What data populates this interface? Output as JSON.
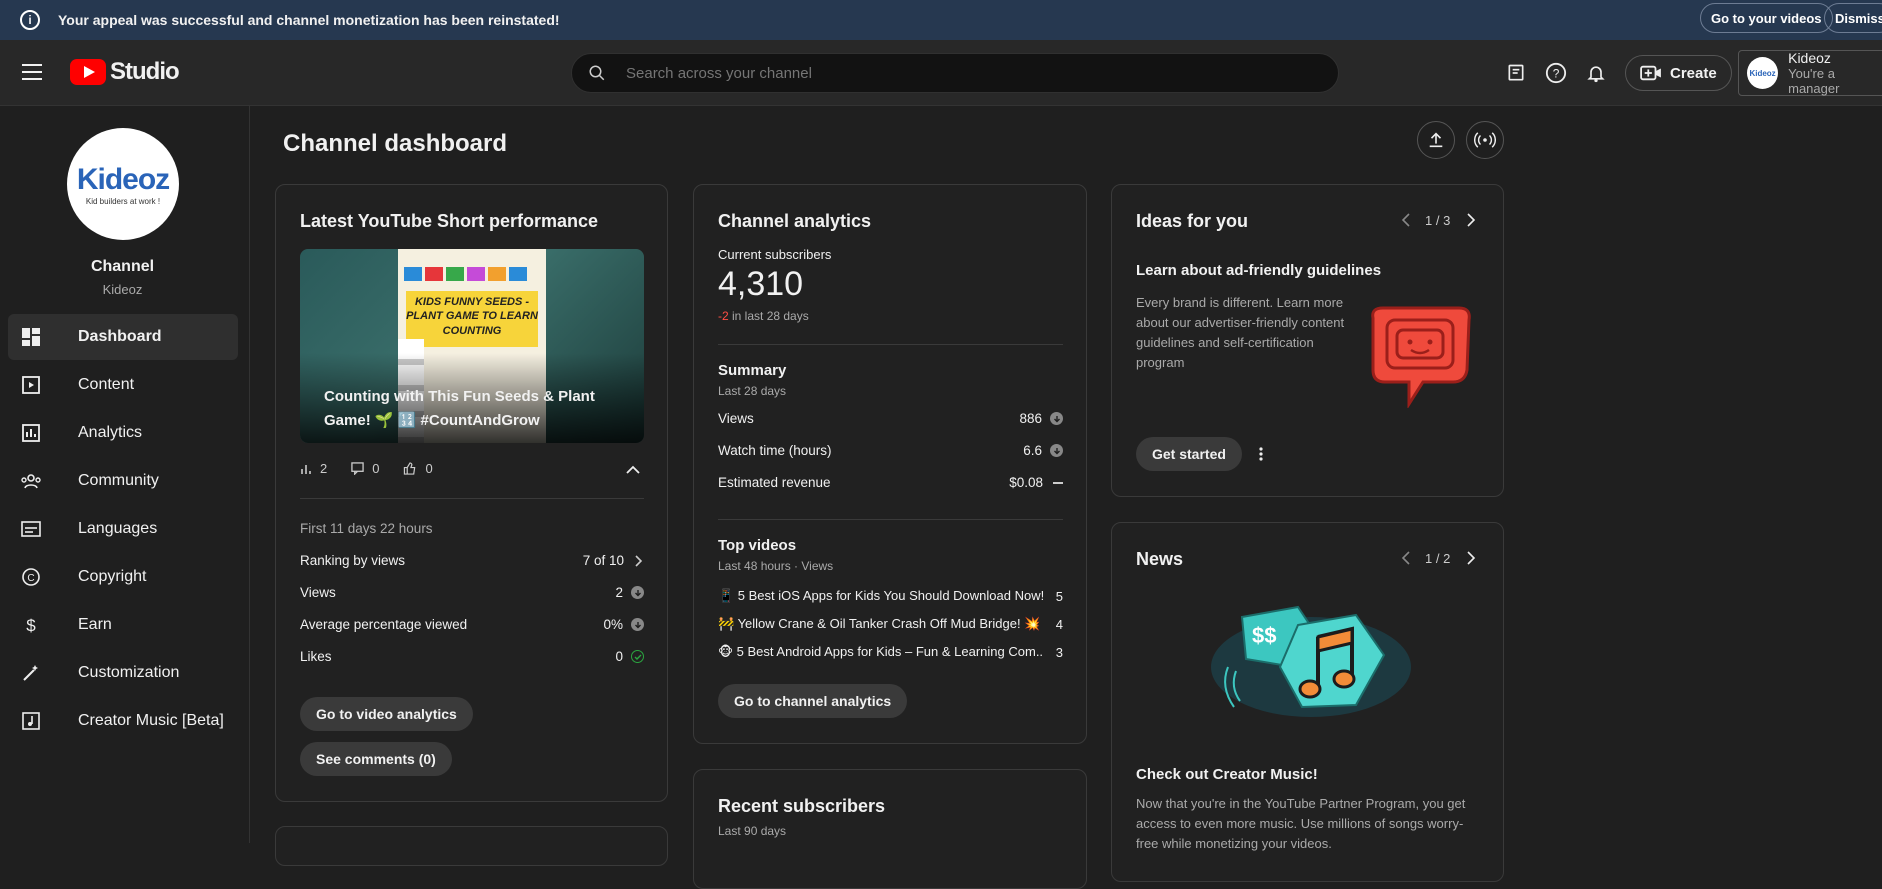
{
  "banner": {
    "message": "Your appeal was successful and channel monetization has been reinstated!",
    "go_videos": "Go to your videos",
    "dismiss": "Dismiss"
  },
  "header": {
    "logo_text": "Studio",
    "search_placeholder": "Search across your channel",
    "create_label": "Create",
    "account_name": "Kideoz",
    "account_role": "You're a manager"
  },
  "sidebar": {
    "avatar_logo": "Kideoz",
    "avatar_tagline": "Kid builders at work !",
    "channel_title": "Channel",
    "channel_name": "Kideoz",
    "items": [
      {
        "label": "Dashboard",
        "icon": "dashboard-icon"
      },
      {
        "label": "Content",
        "icon": "content-icon"
      },
      {
        "label": "Analytics",
        "icon": "analytics-icon"
      },
      {
        "label": "Community",
        "icon": "community-icon"
      },
      {
        "label": "Languages",
        "icon": "languages-icon"
      },
      {
        "label": "Copyright",
        "icon": "copyright-icon"
      },
      {
        "label": "Earn",
        "icon": "earn-icon"
      },
      {
        "label": "Customization",
        "icon": "customization-icon"
      },
      {
        "label": "Creator Music [Beta]",
        "icon": "creator-music-icon"
      }
    ]
  },
  "main": {
    "title": "Channel dashboard"
  },
  "short_card": {
    "title": "Latest YouTube Short performance",
    "thumbnail_banner": "KIDS FUNNY SEEDS - PLANT GAME TO LEARN COUNTING",
    "video_caption": "Counting with This Fun Seeds & Plant Game! 🌱 🔢 #CountAndGrow",
    "views_count": "2",
    "comments_count": "0",
    "likes_count": "0",
    "period": "First 11 days 22 hours",
    "ranking_label": "Ranking by views",
    "ranking_value": "7 of 10",
    "views_label": "Views",
    "views_value": "2",
    "avg_label": "Average percentage viewed",
    "avg_value": "0%",
    "likes_label": "Likes",
    "likes_value": "0",
    "btn_analytics": "Go to video analytics",
    "btn_comments": "See comments (0)"
  },
  "analytics_card": {
    "title": "Channel analytics",
    "subs_label": "Current subscribers",
    "subs_value": "4,310",
    "subs_change": "-2",
    "subs_change_suffix": " in last 28 days",
    "summary_title": "Summary",
    "summary_period": "Last 28 days",
    "metrics": [
      {
        "label": "Views",
        "value": "886"
      },
      {
        "label": "Watch time (hours)",
        "value": "6.6"
      },
      {
        "label": "Estimated revenue",
        "value": "$0.08"
      }
    ],
    "top_title": "Top videos",
    "top_period": "Last 48 hours · Views",
    "top_videos": [
      {
        "title": "📱 5 Best iOS Apps for Kids You Should Download Now!...",
        "views": "5"
      },
      {
        "title": "🚧 Yellow Crane & Oil Tanker Crash Off Mud Bridge! 💥 ...",
        "views": "4"
      },
      {
        "title": "🐵 5 Best Android Apps for Kids – Fun & Learning Com...",
        "views": "3"
      }
    ],
    "btn": "Go to channel analytics"
  },
  "recent_card": {
    "title": "Recent subscribers",
    "period": "Last 90 days"
  },
  "ideas_card": {
    "title": "Ideas for you",
    "pager": "1 / 3",
    "heading": "Learn about ad-friendly guidelines",
    "body": "Every brand is different. Learn more about our advertiser-friendly content guidelines and self-certification program",
    "btn": "Get started"
  },
  "news_card": {
    "title": "News",
    "pager": "1 / 2",
    "heading": "Check out Creator Music!",
    "body": "Now that you're in the YouTube Partner Program, you get access to even more music. Use millions of songs worry-free while monetizing your videos."
  },
  "colors": {
    "banner_bg": "#263850",
    "accent_red": "#ff0000",
    "negative": "#ff4e45",
    "success": "#2ba640"
  }
}
